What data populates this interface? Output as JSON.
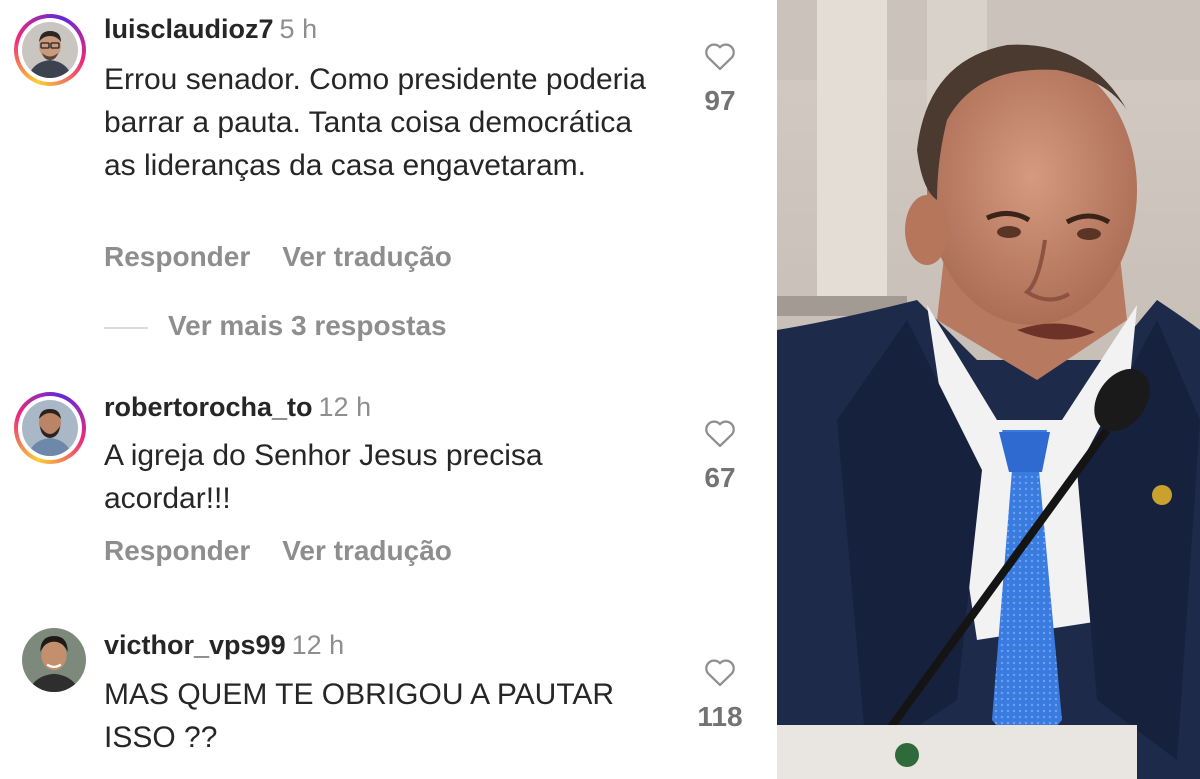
{
  "comments": [
    {
      "username": "luisclaudioz7",
      "time": "5 h",
      "text": "Errou senador. Como presidente poderia barrar a pauta. Tanta coisa democrática as lideranças da casa engavetaram.",
      "likes": "97",
      "reply_label": "Responder",
      "translate_label": "Ver tradução"
    },
    {
      "username": "robertorocha_to",
      "time": "12 h",
      "text": "A igreja do Senhor Jesus precisa acordar!!!",
      "likes": "67",
      "reply_label": "Responder",
      "translate_label": "Ver tradução"
    },
    {
      "username": "victhor_vps99",
      "time": "12 h",
      "text": "MAS QUEM TE OBRIGOU A PAUTAR ISSO ??",
      "likes": "118"
    }
  ],
  "more_replies_label": "Ver mais 3 respostas",
  "colors": {
    "text": "#262626",
    "muted": "#8e8e8e",
    "story_ring": "#ee2a7b",
    "suit": "#1d2a4a",
    "tie": "#3a7be0"
  }
}
